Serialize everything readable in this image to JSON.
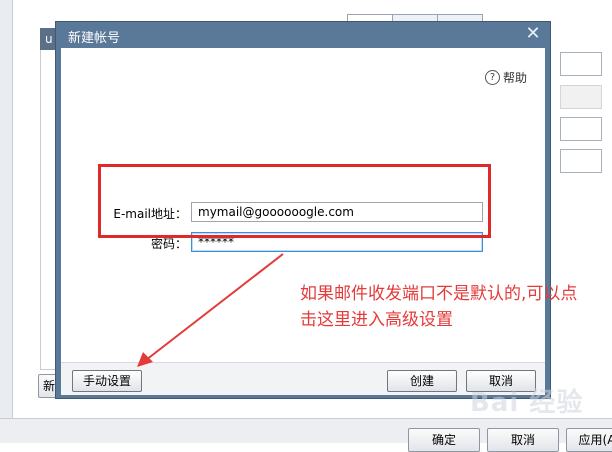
{
  "background": {
    "list_header": "u",
    "bottom_buttons": {
      "ok": "确定",
      "cancel": "取消",
      "apply": "应用(A"
    },
    "left_button_fragment": "新"
  },
  "dialog": {
    "title": "新建帐号",
    "close_glyph": "✕",
    "help_icon_glyph": "?",
    "help_label": "帮助",
    "email_label": "E-mail地址：",
    "email_value": "mymail@goooooogle.com",
    "password_label": "密码：",
    "password_value": "******",
    "manual_settings_button": "手动设置",
    "create_button": "创建",
    "cancel_button": "取消"
  },
  "annotation": {
    "note_text": "如果邮件收发端口不是默认的,可以点\n击这里进入高级设置",
    "highlight_color": "#e02a2a",
    "arrow_color": "#e53a3a"
  },
  "watermark": "Bai 经验"
}
